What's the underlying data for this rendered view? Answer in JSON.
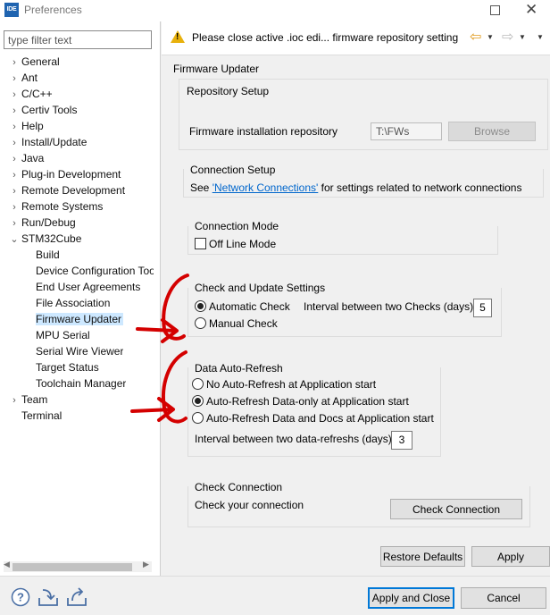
{
  "window": {
    "app_badge": "IDE",
    "title": "Preferences"
  },
  "filter": {
    "placeholder": "type filter text"
  },
  "tree": {
    "items": [
      {
        "label": "General",
        "expand": "›"
      },
      {
        "label": "Ant",
        "expand": "›"
      },
      {
        "label": "C/C++",
        "expand": "›"
      },
      {
        "label": "Certiv Tools",
        "expand": "›"
      },
      {
        "label": "Help",
        "expand": "›"
      },
      {
        "label": "Install/Update",
        "expand": "›"
      },
      {
        "label": "Java",
        "expand": "›"
      },
      {
        "label": "Plug-in Development",
        "expand": "›"
      },
      {
        "label": "Remote Development",
        "expand": "›"
      },
      {
        "label": "Remote Systems",
        "expand": "›"
      },
      {
        "label": "Run/Debug",
        "expand": "›"
      },
      {
        "label": "STM32Cube",
        "expand": "⌄"
      }
    ],
    "children": [
      "Build",
      "Device Configuration Tool",
      "End User Agreements",
      "File Association",
      "Firmware Updater",
      "MPU Serial",
      "Serial Wire Viewer",
      "Target Status",
      "Toolchain Manager"
    ],
    "after": [
      {
        "label": "Team",
        "expand": "›"
      },
      {
        "label": "Terminal",
        "expand": ""
      }
    ]
  },
  "message": {
    "text": "Please close active .ioc edi... firmware repository setting"
  },
  "page": {
    "title": "Firmware Updater",
    "repository": {
      "title": "Repository Setup",
      "label": "Firmware installation repository",
      "value": "T:\\FWs",
      "browse": "Browse"
    },
    "connection_setup": {
      "title": "Connection Setup",
      "pre": "See ",
      "link": "'Network Connections'",
      "post": " for settings related to network connections"
    },
    "connection_mode": {
      "title": "Connection Mode",
      "offline": "Off Line Mode"
    },
    "check_update": {
      "title": "Check and Update Settings",
      "automatic": "Automatic Check",
      "interval_label": "Interval between two Checks (days)",
      "interval_value": "5",
      "manual": "Manual Check"
    },
    "auto_refresh": {
      "title": "Data Auto-Refresh",
      "opt1": "No Auto-Refresh at Application start",
      "opt2": "Auto-Refresh Data-only at Application start",
      "opt3": "Auto-Refresh Data and Docs at Application start",
      "interval_label": "Interval between two data-refreshs (days)",
      "interval_value": "3"
    },
    "check_connection": {
      "title": "Check Connection",
      "label": "Check your connection",
      "button": "Check Connection"
    },
    "restore_defaults": "Restore Defaults",
    "apply": "Apply"
  },
  "footer": {
    "apply_close": "Apply and Close",
    "cancel": "Cancel"
  },
  "colors": {
    "annotation": "#d40000",
    "selection": "#cde8ff",
    "accent": "#0078d7",
    "link": "#0066cc"
  }
}
